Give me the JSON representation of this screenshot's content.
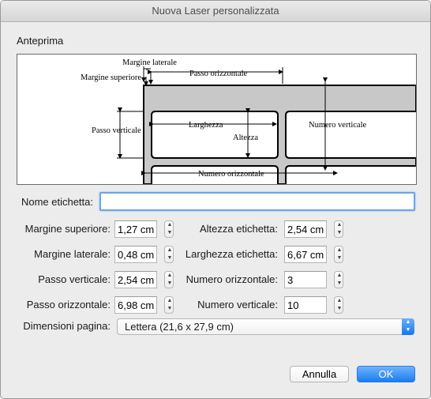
{
  "window": {
    "title": "Nuova Laser personalizzata"
  },
  "preview": {
    "heading": "Anteprima",
    "labels": {
      "side_margin": "Margine laterale",
      "top_margin": "Margine superiore",
      "horizontal_pitch": "Passo orizzontale",
      "vertical_pitch": "Passo verticale",
      "width": "Larghezza",
      "height": "Altezza",
      "number_down": "Numero verticale",
      "number_across": "Numero orizzontale"
    }
  },
  "form": {
    "label_name": {
      "label": "Nome etichetta:",
      "value": ""
    },
    "top_margin": {
      "label": "Margine superiore:",
      "value": "1,27 cm"
    },
    "side_margin": {
      "label": "Margine laterale:",
      "value": "0,48 cm"
    },
    "vertical_pitch": {
      "label": "Passo verticale:",
      "value": "2,54 cm"
    },
    "horizontal_pitch": {
      "label": "Passo orizzontale:",
      "value": "6,98 cm"
    },
    "label_height": {
      "label": "Altezza etichetta:",
      "value": "2,54 cm"
    },
    "label_width": {
      "label": "Larghezza etichetta:",
      "value": "6,67 cm"
    },
    "number_across": {
      "label": "Numero orizzontale:",
      "value": "3"
    },
    "number_down": {
      "label": "Numero verticale:",
      "value": "10"
    },
    "page_size": {
      "label": "Dimensioni pagina:",
      "value": "Lettera (21,6 x 27,9 cm)"
    }
  },
  "buttons": {
    "cancel": "Annulla",
    "ok": "OK"
  },
  "colors": {
    "accent": "#1c7cf0",
    "focus_ring": "#6aa5ea",
    "label_fill": "#c8c8c8"
  },
  "icons": {
    "stepper_up": "▲",
    "stepper_down": "▼"
  }
}
